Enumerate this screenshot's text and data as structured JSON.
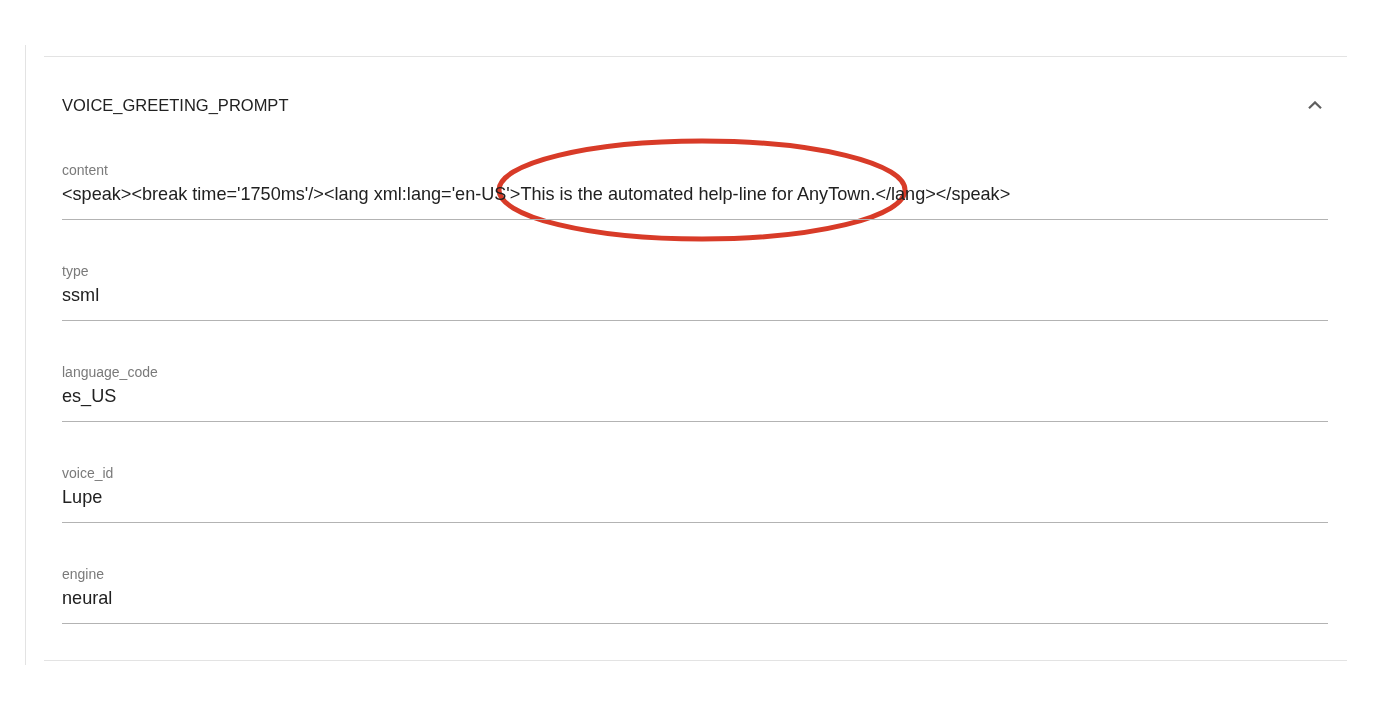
{
  "panel": {
    "title": "VOICE_GREETING_PROMPT",
    "expanded": true,
    "fields": [
      {
        "label": "content",
        "value": "<speak><break time='1750ms'/><lang xml:lang='en-US'>This is the automated help-line for AnyTown.</lang></speak>",
        "circled": true
      },
      {
        "label": "type",
        "value": "ssml",
        "circled": false
      },
      {
        "label": "language_code",
        "value": "es_US",
        "circled": false
      },
      {
        "label": "voice_id",
        "value": "Lupe",
        "circled": false
      },
      {
        "label": "engine",
        "value": "neural",
        "circled": false
      }
    ]
  }
}
